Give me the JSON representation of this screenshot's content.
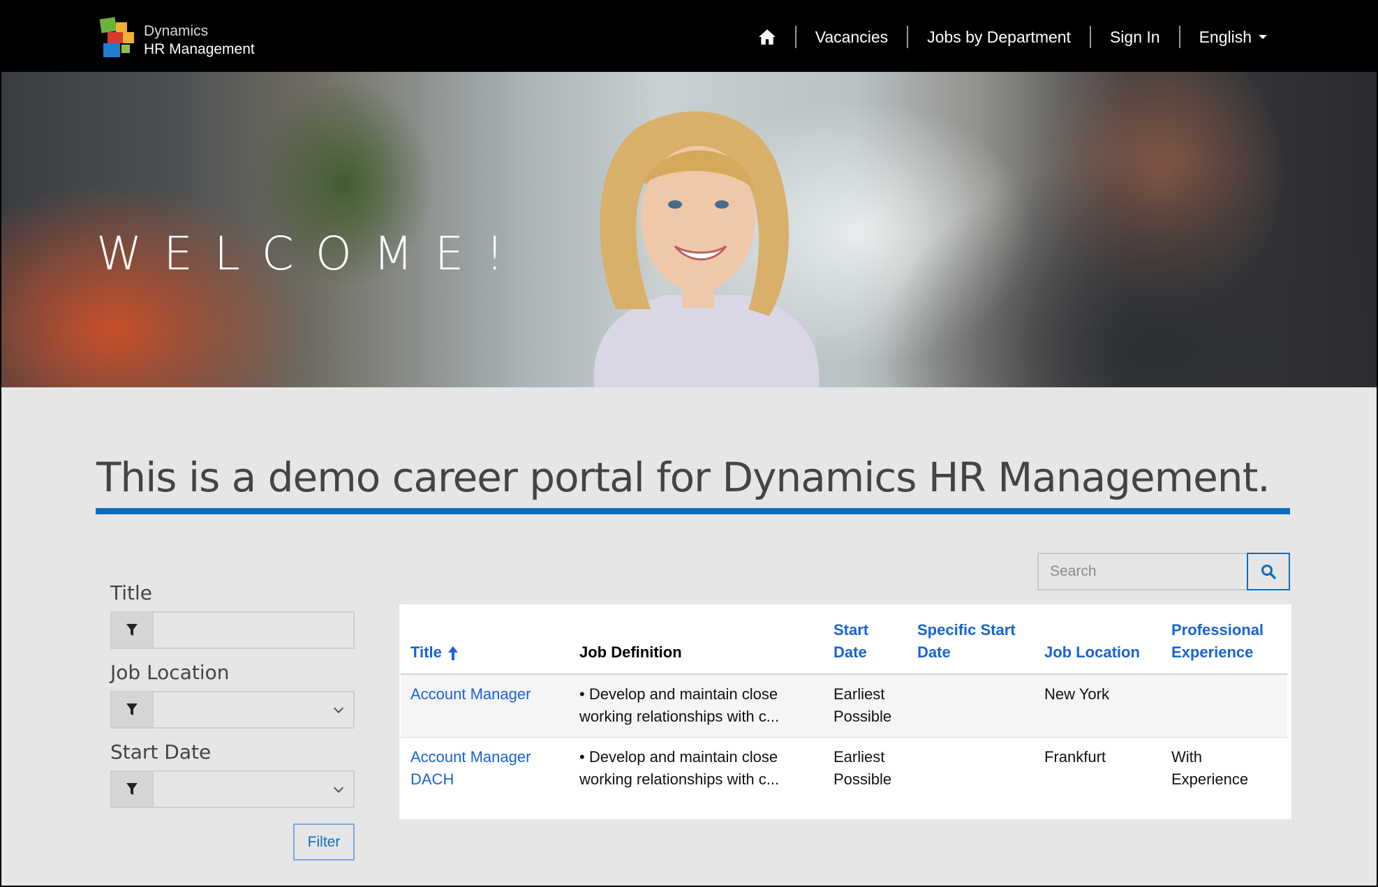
{
  "header": {
    "logo_line1": "Dynamics",
    "logo_line2": "HR Management",
    "nav": {
      "vacancies": "Vacancies",
      "jobs_by_department": "Jobs by Department",
      "sign_in": "Sign In",
      "language": "English"
    }
  },
  "hero": {
    "welcome": "WELCOME!"
  },
  "main": {
    "headline": "This is a demo career portal for Dynamics HR Management.",
    "search": {
      "placeholder": "Search"
    },
    "filters": {
      "title_label": "Title",
      "location_label": "Job Location",
      "start_date_label": "Start Date",
      "filter_button": "Filter"
    },
    "table": {
      "headers": {
        "title": "Title",
        "job_definition": "Job Definition",
        "start_date": "Start Date",
        "specific_start_date": "Specific Start Date",
        "job_location": "Job Location",
        "professional_experience": "Professional Experience"
      },
      "rows": [
        {
          "title": "Account Manager",
          "job_definition": "• Develop and maintain close working relationships with c...",
          "start_date": "Earliest Possible",
          "specific_start_date": "",
          "job_location": "New York",
          "professional_experience": ""
        },
        {
          "title": "Account Manager DACH",
          "job_definition": "• Develop and maintain close working relationships with c...",
          "start_date": "Earliest Possible",
          "specific_start_date": "",
          "job_location": "Frankfurt",
          "professional_experience": "With Experience"
        }
      ]
    }
  },
  "colors": {
    "accent": "#0f6cbd",
    "link": "#1a62d8",
    "topbar": "#000000"
  },
  "icons": {
    "home": "home-icon",
    "search": "search-icon",
    "filter": "funnel-icon",
    "sort": "arrow-up-icon",
    "dropdown": "chevron-down-icon"
  }
}
